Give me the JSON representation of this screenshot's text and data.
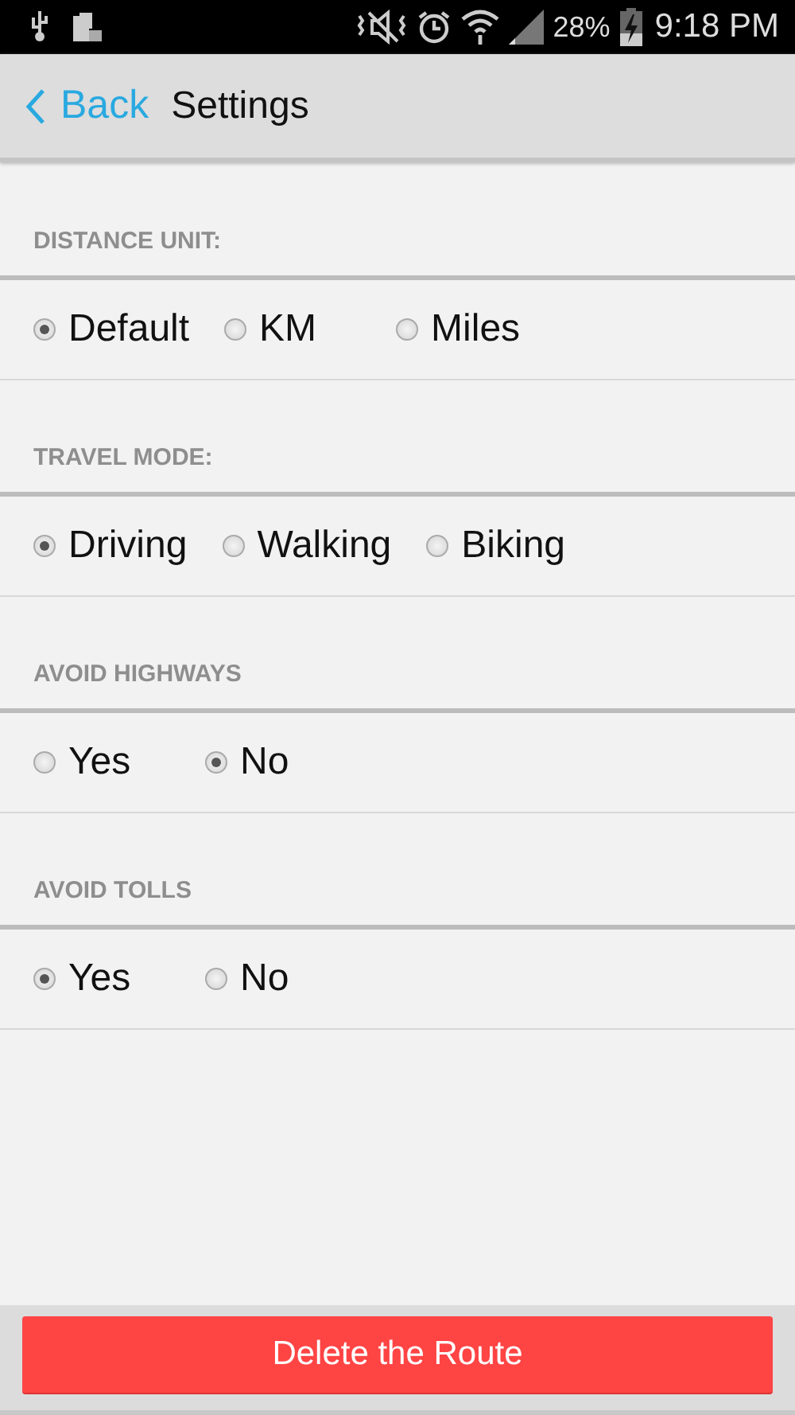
{
  "status_bar": {
    "battery": "28%",
    "time": "9:18 PM"
  },
  "header": {
    "back": "Back",
    "title": "Settings"
  },
  "sections": [
    {
      "label": "DISTANCE UNIT:",
      "options": [
        {
          "label": "Default",
          "selected": true
        },
        {
          "label": "KM",
          "selected": false
        },
        {
          "label": "Miles",
          "selected": false
        }
      ]
    },
    {
      "label": "TRAVEL MODE:",
      "options": [
        {
          "label": "Driving",
          "selected": true
        },
        {
          "label": "Walking",
          "selected": false
        },
        {
          "label": "Biking",
          "selected": false
        }
      ]
    },
    {
      "label": "AVOID HIGHWAYS",
      "options": [
        {
          "label": "Yes",
          "selected": false
        },
        {
          "label": "No",
          "selected": true
        }
      ]
    },
    {
      "label": "AVOID TOLLS",
      "options": [
        {
          "label": "Yes",
          "selected": true
        },
        {
          "label": "No",
          "selected": false
        }
      ]
    }
  ],
  "delete_button": "Delete the Route"
}
